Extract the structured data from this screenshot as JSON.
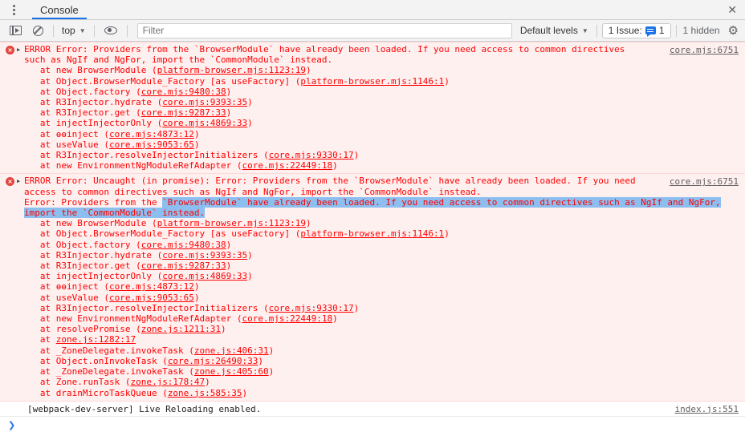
{
  "colors": {
    "accent": "#1a73e8",
    "error_text": "#ff0000",
    "error_bg": "#fff0f0",
    "error_border": "#ffd7d7",
    "selection": "#8cbef0",
    "issue_bubble": "#1a73e8"
  },
  "tab_bar": {
    "title": "Console",
    "close_label": "✕"
  },
  "toolbar": {
    "top_label": "top",
    "filter_placeholder": "Filter",
    "levels_label": "Default levels",
    "issues_label": "1 Issue:",
    "issues_count": "1",
    "hidden_label": "1 hidden",
    "gear_glyph": "⚙"
  },
  "console": {
    "prompt_glyph": "❯",
    "rows": [
      {
        "kind": "error",
        "anchor": "core.mjs:6751",
        "lines": [
          [
            {
              "t": "p",
              "x": "ERROR Error: Providers from the `BrowserModule` have already been loaded. If you need access to common directives"
            }
          ],
          [
            {
              "t": "p",
              "x": "such as NgIf and NgFor, import the `CommonModule` instead."
            }
          ],
          [
            {
              "t": "p",
              "x": "   at new BrowserModule ("
            },
            {
              "t": "l",
              "x": "platform-browser.mjs:1123:19"
            },
            {
              "t": "p",
              "x": ")"
            }
          ],
          [
            {
              "t": "p",
              "x": "   at Object.BrowserModule_Factory [as useFactory] ("
            },
            {
              "t": "l",
              "x": "platform-browser.mjs:1146:1"
            },
            {
              "t": "p",
              "x": ")"
            }
          ],
          [
            {
              "t": "p",
              "x": "   at Object.factory ("
            },
            {
              "t": "l",
              "x": "core.mjs:9480:38"
            },
            {
              "t": "p",
              "x": ")"
            }
          ],
          [
            {
              "t": "p",
              "x": "   at R3Injector.hydrate ("
            },
            {
              "t": "l",
              "x": "core.mjs:9393:35"
            },
            {
              "t": "p",
              "x": ")"
            }
          ],
          [
            {
              "t": "p",
              "x": "   at R3Injector.get ("
            },
            {
              "t": "l",
              "x": "core.mjs:9287:33"
            },
            {
              "t": "p",
              "x": ")"
            }
          ],
          [
            {
              "t": "p",
              "x": "   at injectInjectorOnly ("
            },
            {
              "t": "l",
              "x": "core.mjs:4869:33"
            },
            {
              "t": "p",
              "x": ")"
            }
          ],
          [
            {
              "t": "p",
              "x": "   at ɵɵinject ("
            },
            {
              "t": "l",
              "x": "core.mjs:4873:12"
            },
            {
              "t": "p",
              "x": ")"
            }
          ],
          [
            {
              "t": "p",
              "x": "   at useValue ("
            },
            {
              "t": "l",
              "x": "core.mjs:9053:65"
            },
            {
              "t": "p",
              "x": ")"
            }
          ],
          [
            {
              "t": "p",
              "x": "   at R3Injector.resolveInjectorInitializers ("
            },
            {
              "t": "l",
              "x": "core.mjs:9330:17"
            },
            {
              "t": "p",
              "x": ")"
            }
          ],
          [
            {
              "t": "p",
              "x": "   at new EnvironmentNgModuleRefAdapter ("
            },
            {
              "t": "l",
              "x": "core.mjs:22449:18"
            },
            {
              "t": "p",
              "x": ")"
            }
          ]
        ]
      },
      {
        "kind": "error",
        "anchor": "core.mjs:6751",
        "lines": [
          [
            {
              "t": "p",
              "x": "ERROR Error: Uncaught (in promise): Error: Providers from the `BrowserModule` have already been loaded. If you need"
            }
          ],
          [
            {
              "t": "p",
              "x": "access to common directives such as NgIf and NgFor, import the `CommonModule` instead."
            }
          ],
          [
            {
              "t": "p",
              "x": "Error: Providers from the "
            },
            {
              "t": "s",
              "x": "`BrowserModule` have already been loaded. If you need access to common directives such as NgIf and NgFor,"
            }
          ],
          [
            {
              "t": "s",
              "x": "import the `CommonModule` instead."
            }
          ],
          [
            {
              "t": "p",
              "x": "   at new BrowserModule ("
            },
            {
              "t": "l",
              "x": "platform-browser.mjs:1123:19"
            },
            {
              "t": "p",
              "x": ")"
            }
          ],
          [
            {
              "t": "p",
              "x": "   at Object.BrowserModule_Factory [as useFactory] ("
            },
            {
              "t": "l",
              "x": "platform-browser.mjs:1146:1"
            },
            {
              "t": "p",
              "x": ")"
            }
          ],
          [
            {
              "t": "p",
              "x": "   at Object.factory ("
            },
            {
              "t": "l",
              "x": "core.mjs:9480:38"
            },
            {
              "t": "p",
              "x": ")"
            }
          ],
          [
            {
              "t": "p",
              "x": "   at R3Injector.hydrate ("
            },
            {
              "t": "l",
              "x": "core.mjs:9393:35"
            },
            {
              "t": "p",
              "x": ")"
            }
          ],
          [
            {
              "t": "p",
              "x": "   at R3Injector.get ("
            },
            {
              "t": "l",
              "x": "core.mjs:9287:33"
            },
            {
              "t": "p",
              "x": ")"
            }
          ],
          [
            {
              "t": "p",
              "x": "   at injectInjectorOnly ("
            },
            {
              "t": "l",
              "x": "core.mjs:4869:33"
            },
            {
              "t": "p",
              "x": ")"
            }
          ],
          [
            {
              "t": "p",
              "x": "   at ɵɵinject ("
            },
            {
              "t": "l",
              "x": "core.mjs:4873:12"
            },
            {
              "t": "p",
              "x": ")"
            }
          ],
          [
            {
              "t": "p",
              "x": "   at useValue ("
            },
            {
              "t": "l",
              "x": "core.mjs:9053:65"
            },
            {
              "t": "p",
              "x": ")"
            }
          ],
          [
            {
              "t": "p",
              "x": "   at R3Injector.resolveInjectorInitializers ("
            },
            {
              "t": "l",
              "x": "core.mjs:9330:17"
            },
            {
              "t": "p",
              "x": ")"
            }
          ],
          [
            {
              "t": "p",
              "x": "   at new EnvironmentNgModuleRefAdapter ("
            },
            {
              "t": "l",
              "x": "core.mjs:22449:18"
            },
            {
              "t": "p",
              "x": ")"
            }
          ],
          [
            {
              "t": "p",
              "x": "   at resolvePromise ("
            },
            {
              "t": "l",
              "x": "zone.js:1211:31"
            },
            {
              "t": "p",
              "x": ")"
            }
          ],
          [
            {
              "t": "p",
              "x": "   at "
            },
            {
              "t": "l",
              "x": "zone.js:1282:17"
            }
          ],
          [
            {
              "t": "p",
              "x": "   at _ZoneDelegate.invokeTask ("
            },
            {
              "t": "l",
              "x": "zone.js:406:31"
            },
            {
              "t": "p",
              "x": ")"
            }
          ],
          [
            {
              "t": "p",
              "x": "   at Object.onInvokeTask ("
            },
            {
              "t": "l",
              "x": "core.mjs:26490:33"
            },
            {
              "t": "p",
              "x": ")"
            }
          ],
          [
            {
              "t": "p",
              "x": "   at _ZoneDelegate.invokeTask ("
            },
            {
              "t": "l",
              "x": "zone.js:405:60"
            },
            {
              "t": "p",
              "x": ")"
            }
          ],
          [
            {
              "t": "p",
              "x": "   at Zone.runTask ("
            },
            {
              "t": "l",
              "x": "zone.js:178:47"
            },
            {
              "t": "p",
              "x": ")"
            }
          ],
          [
            {
              "t": "p",
              "x": "   at drainMicroTaskQueue ("
            },
            {
              "t": "l",
              "x": "zone.js:585:35"
            },
            {
              "t": "p",
              "x": ")"
            }
          ]
        ]
      },
      {
        "kind": "log",
        "anchor": "index.js:551",
        "lines": [
          [
            {
              "t": "p",
              "x": "[webpack-dev-server] Live Reloading enabled."
            }
          ]
        ]
      }
    ]
  }
}
